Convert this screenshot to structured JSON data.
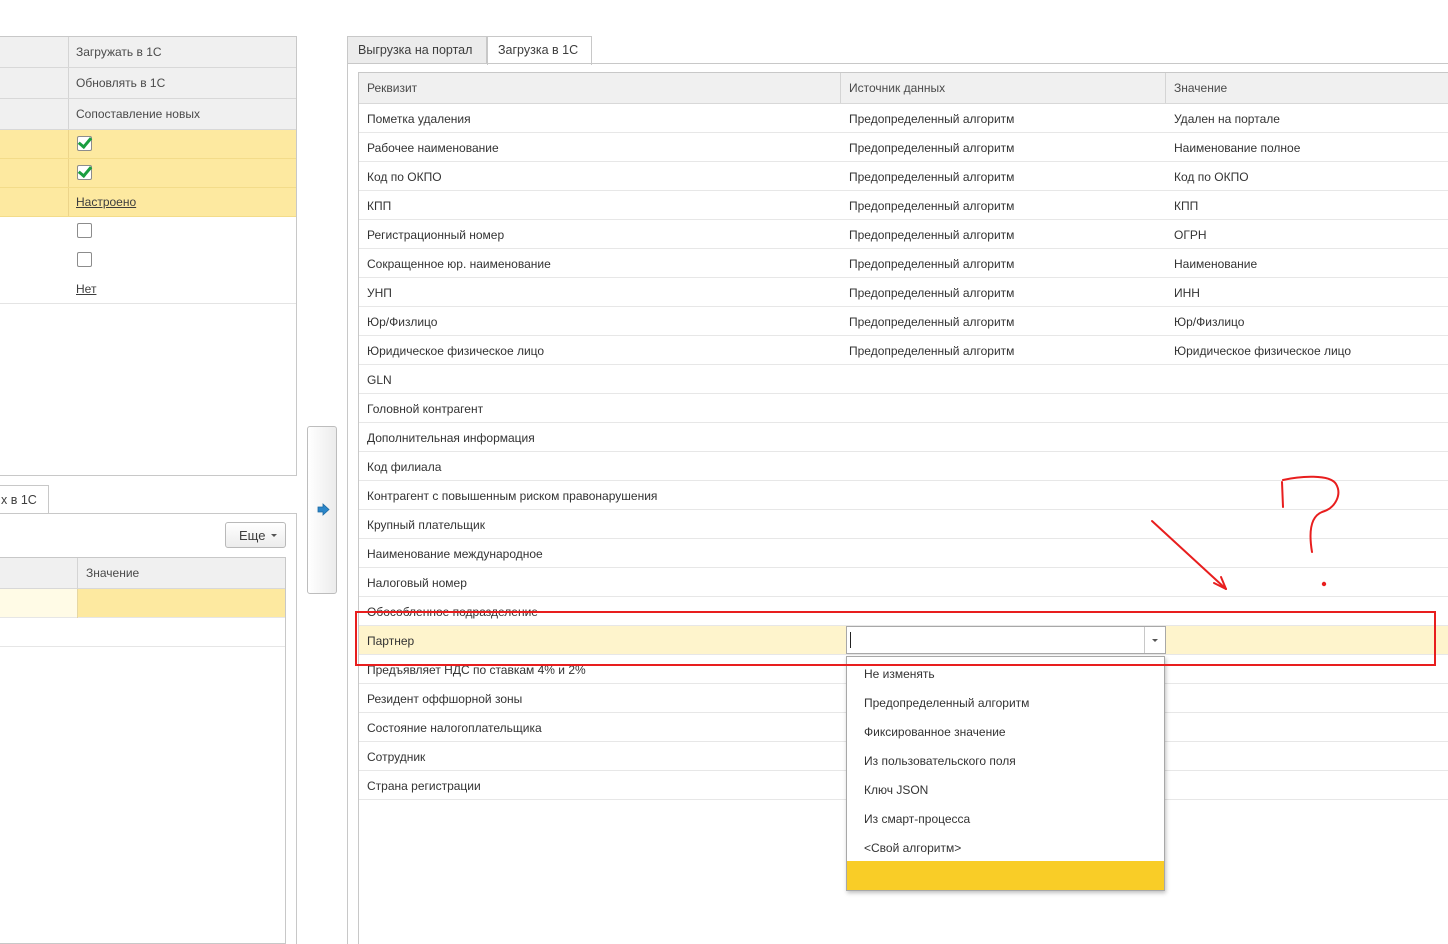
{
  "left_settings": {
    "rows": [
      {
        "label": "Загружать в 1С"
      },
      {
        "label": "Обновлять в 1С"
      },
      {
        "label": "Сопоставление новых"
      }
    ],
    "values": [
      {
        "kind": "checkbox",
        "checked": true
      },
      {
        "kind": "checkbox",
        "checked": true
      },
      {
        "kind": "link",
        "text": "Настроено"
      },
      {
        "kind": "checkbox",
        "checked": false
      },
      {
        "kind": "checkbox",
        "checked": false
      },
      {
        "kind": "link",
        "text": "Нет"
      }
    ]
  },
  "left_lower": {
    "tab_label": "х в 1С",
    "more_button": "Еще",
    "column_header": "Значение"
  },
  "tabs": [
    {
      "label": "Выгрузка на портал",
      "active": false
    },
    {
      "label": "Загрузка в 1С",
      "active": true
    }
  ],
  "grid": {
    "columns": [
      "Реквизит",
      "Источник данных",
      "Значение"
    ],
    "rows": [
      [
        "Пометка удаления",
        "Предопределенный алгоритм",
        "Удален на портале"
      ],
      [
        "Рабочее наименование",
        "Предопределенный алгоритм",
        "Наименование полное"
      ],
      [
        "Код по ОКПО",
        "Предопределенный алгоритм",
        "Код по ОКПО"
      ],
      [
        "КПП",
        "Предопределенный алгоритм",
        "КПП"
      ],
      [
        "Регистрационный номер",
        "Предопределенный алгоритм",
        "ОГРН"
      ],
      [
        "Сокращенное юр. наименование",
        "Предопределенный алгоритм",
        "Наименование"
      ],
      [
        "УНП",
        "Предопределенный алгоритм",
        "ИНН"
      ],
      [
        "Юр/Физлицо",
        "Предопределенный алгоритм",
        "Юр/Физлицо"
      ],
      [
        "Юридическое физическое лицо",
        "Предопределенный алгоритм",
        "Юридическое физическое лицо"
      ],
      [
        "GLN",
        "",
        ""
      ],
      [
        "Головной контрагент",
        "",
        ""
      ],
      [
        "Дополнительная информация",
        "",
        ""
      ],
      [
        "Код филиала",
        "",
        ""
      ],
      [
        "Контрагент с повышенным риском правонарушения",
        "",
        ""
      ],
      [
        "Крупный плательщик",
        "",
        ""
      ],
      [
        "Наименование международное",
        "",
        ""
      ],
      [
        "Налоговый номер",
        "",
        ""
      ],
      [
        "Обособленное подразделение",
        "",
        ""
      ],
      [
        "Партнер",
        "",
        ""
      ],
      [
        "Предъявляет НДС по ставкам 4% и 2%",
        "",
        ""
      ],
      [
        "Резидент оффшорной зоны",
        "",
        ""
      ],
      [
        "Состояние налогоплательщика",
        "",
        ""
      ],
      [
        "Сотрудник",
        "",
        ""
      ],
      [
        "Страна регистрации",
        "",
        ""
      ]
    ],
    "selected_row": 18
  },
  "dropdown": {
    "input_value": "",
    "options": [
      "Не изменять",
      "Предопределенный алгоритм",
      "Фиксированное значение",
      "Из пользовательского поля",
      "Ключ JSON",
      "Из смарт-процесса",
      "<Свой алгоритм>",
      ""
    ],
    "highlighted": 7
  },
  "colors": {
    "accent_yellow": "#fde9a0",
    "dropdown_highlight": "#f9cd27",
    "annotation_red": "#e81e1e",
    "checkbox_green": "#1a9e3f"
  }
}
